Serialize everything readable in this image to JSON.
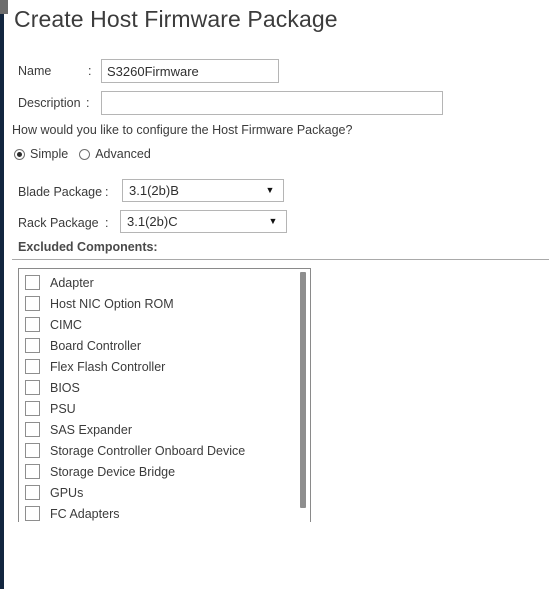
{
  "window": {
    "title": "Create Host Firmware Package"
  },
  "form": {
    "name": {
      "label": "Name",
      "colon": ":",
      "value": "S3260Firmware",
      "placeholder": ""
    },
    "description": {
      "label": "Description",
      "colon": ":",
      "value": "",
      "placeholder": ""
    },
    "question": "How would you like to configure the Host Firmware Package?",
    "mode": {
      "selected": "Simple",
      "options": [
        {
          "label": "Simple",
          "checked": true
        },
        {
          "label": "Advanced",
          "checked": false
        }
      ]
    },
    "blade_package": {
      "label": "Blade Package",
      "colon": ":",
      "value": "3.1(2b)B",
      "arrow": "▼"
    },
    "rack_package": {
      "label": "Rack Package",
      "colon": ":",
      "value": "3.1(2b)C",
      "arrow": "▼"
    }
  },
  "excluded_components": {
    "title": "Excluded Components:",
    "items": [
      {
        "label": "Adapter",
        "checked": false
      },
      {
        "label": "Host NIC Option ROM",
        "checked": false
      },
      {
        "label": "CIMC",
        "checked": false
      },
      {
        "label": "Board Controller",
        "checked": false
      },
      {
        "label": "Flex Flash Controller",
        "checked": false
      },
      {
        "label": "BIOS",
        "checked": false
      },
      {
        "label": "PSU",
        "checked": false
      },
      {
        "label": "SAS Expander",
        "checked": false
      },
      {
        "label": "Storage Controller Onboard Device",
        "checked": false
      },
      {
        "label": "Storage Device Bridge",
        "checked": false
      },
      {
        "label": "GPUs",
        "checked": false
      },
      {
        "label": "FC Adapters",
        "checked": false
      }
    ]
  },
  "colors": {
    "accent_stripe": "#12263f",
    "text": "#3b3b3b",
    "border": "#b5b5b5",
    "listbox_border": "#8a8a8a",
    "scrollbar": "#8e8e8e",
    "background": "#ffffff"
  }
}
